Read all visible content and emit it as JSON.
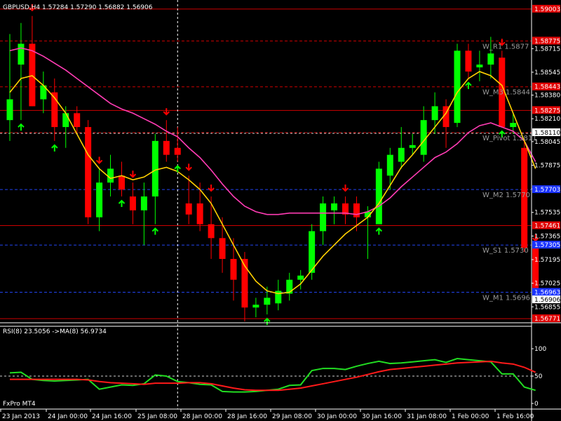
{
  "main_header": "GBPUSD,H4  1.57284 1.57290 1.56882 1.56906",
  "rsi_header": "RSI(8) 23.5056  ->MA(8) 56.9734",
  "broker": "FxPro MT4",
  "colors": {
    "background": "#000000",
    "bull": "#00ff00",
    "bear": "#ff0000",
    "ma_fast": "#ffd000",
    "ma_slow": "#ff3cb4",
    "rsi": "#22dd22",
    "rsi_ma": "#ff1a1a",
    "level_red": "#cc0000",
    "level_blue": "#2244ee",
    "grid_white": "#cfcfcf",
    "price_box": "#ffffff",
    "label_gray": "#9a9a9a"
  },
  "chart_data": [
    {
      "type": "candlestick",
      "symbol": "GBPUSD",
      "timeframe": "H4",
      "ylim": [
        1.5673,
        1.5904
      ],
      "y_ticks": [
        "1.58715",
        "1.58545",
        "1.58380",
        "1.58210",
        "1.58045",
        "1.57875",
        "1.57705",
        "1.57535",
        "1.57365",
        "1.57195",
        "1.57025",
        "1.56855"
      ],
      "x_ticks": [
        "23 Jan 2013",
        "24 Jan 00:00",
        "24 Jan 16:00",
        "25 Jan 08:00",
        "28 Jan 00:00",
        "28 Jan 16:00",
        "29 Jan 08:00",
        "30 Jan 00:00",
        "30 Jan 16:00",
        "31 Jan 08:00",
        "1 Feb 00:00",
        "1 Feb 16:00"
      ],
      "candles": [
        {
          "o": 1.582,
          "h": 1.5882,
          "l": 1.5805,
          "c": 1.5835
        },
        {
          "o": 1.586,
          "h": 1.589,
          "l": 1.582,
          "c": 1.5875
        },
        {
          "o": 1.5875,
          "h": 1.5895,
          "l": 1.583,
          "c": 1.583
        },
        {
          "o": 1.5835,
          "h": 1.5855,
          "l": 1.5825,
          "c": 1.5845
        },
        {
          "o": 1.584,
          "h": 1.585,
          "l": 1.5805,
          "c": 1.5815
        },
        {
          "o": 1.5815,
          "h": 1.583,
          "l": 1.58,
          "c": 1.5825
        },
        {
          "o": 1.5825,
          "h": 1.583,
          "l": 1.581,
          "c": 1.5815
        },
        {
          "o": 1.5815,
          "h": 1.582,
          "l": 1.5745,
          "c": 1.575
        },
        {
          "o": 1.575,
          "h": 1.5785,
          "l": 1.574,
          "c": 1.5775
        },
        {
          "o": 1.5775,
          "h": 1.5795,
          "l": 1.5765,
          "c": 1.5785
        },
        {
          "o": 1.578,
          "h": 1.579,
          "l": 1.5765,
          "c": 1.577
        },
        {
          "o": 1.5765,
          "h": 1.5775,
          "l": 1.5745,
          "c": 1.5755
        },
        {
          "o": 1.5755,
          "h": 1.5775,
          "l": 1.573,
          "c": 1.5765
        },
        {
          "o": 1.5765,
          "h": 1.581,
          "l": 1.5745,
          "c": 1.5805
        },
        {
          "o": 1.5805,
          "h": 1.582,
          "l": 1.579,
          "c": 1.5795
        },
        {
          "o": 1.58,
          "h": 1.5815,
          "l": 1.579,
          "c": 1.5795
        },
        {
          "o": 1.576,
          "h": 1.578,
          "l": 1.5745,
          "c": 1.5752
        },
        {
          "o": 1.576,
          "h": 1.5775,
          "l": 1.574,
          "c": 1.5745
        },
        {
          "o": 1.5745,
          "h": 1.5765,
          "l": 1.572,
          "c": 1.5735
        },
        {
          "o": 1.5735,
          "h": 1.575,
          "l": 1.571,
          "c": 1.572
        },
        {
          "o": 1.572,
          "h": 1.5735,
          "l": 1.569,
          "c": 1.5705
        },
        {
          "o": 1.572,
          "h": 1.5725,
          "l": 1.5675,
          "c": 1.5685
        },
        {
          "o": 1.5685,
          "h": 1.5692,
          "l": 1.5678,
          "c": 1.5687
        },
        {
          "o": 1.5687,
          "h": 1.57,
          "l": 1.568,
          "c": 1.5692
        },
        {
          "o": 1.5688,
          "h": 1.5705,
          "l": 1.5683,
          "c": 1.5697
        },
        {
          "o": 1.5695,
          "h": 1.571,
          "l": 1.569,
          "c": 1.5705
        },
        {
          "o": 1.5705,
          "h": 1.5712,
          "l": 1.5698,
          "c": 1.5708
        },
        {
          "o": 1.571,
          "h": 1.5745,
          "l": 1.5705,
          "c": 1.574
        },
        {
          "o": 1.574,
          "h": 1.5765,
          "l": 1.573,
          "c": 1.576
        },
        {
          "o": 1.5755,
          "h": 1.5765,
          "l": 1.5745,
          "c": 1.576
        },
        {
          "o": 1.576,
          "h": 1.5765,
          "l": 1.5745,
          "c": 1.5752
        },
        {
          "o": 1.576,
          "h": 1.5765,
          "l": 1.574,
          "c": 1.575
        },
        {
          "o": 1.575,
          "h": 1.5758,
          "l": 1.572,
          "c": 1.5754
        },
        {
          "o": 1.5745,
          "h": 1.579,
          "l": 1.5745,
          "c": 1.5785
        },
        {
          "o": 1.578,
          "h": 1.58,
          "l": 1.577,
          "c": 1.5795
        },
        {
          "o": 1.579,
          "h": 1.5815,
          "l": 1.5785,
          "c": 1.58
        },
        {
          "o": 1.58,
          "h": 1.581,
          "l": 1.5795,
          "c": 1.5802
        },
        {
          "o": 1.5795,
          "h": 1.583,
          "l": 1.579,
          "c": 1.582
        },
        {
          "o": 1.582,
          "h": 1.584,
          "l": 1.581,
          "c": 1.583
        },
        {
          "o": 1.583,
          "h": 1.5835,
          "l": 1.58,
          "c": 1.5815
        },
        {
          "o": 1.5818,
          "h": 1.5875,
          "l": 1.5815,
          "c": 1.587
        },
        {
          "o": 1.587,
          "h": 1.5875,
          "l": 1.585,
          "c": 1.5855
        },
        {
          "o": 1.5858,
          "h": 1.587,
          "l": 1.5848,
          "c": 1.586
        },
        {
          "o": 1.586,
          "h": 1.588,
          "l": 1.585,
          "c": 1.5868
        },
        {
          "o": 1.5865,
          "h": 1.587,
          "l": 1.5815,
          "c": 1.5815
        },
        {
          "o": 1.5815,
          "h": 1.5825,
          "l": 1.581,
          "c": 1.5818
        },
        {
          "o": 1.58,
          "h": 1.5805,
          "l": 1.5725,
          "c": 1.5728
        },
        {
          "o": 1.5728,
          "h": 1.5729,
          "l": 1.5688,
          "c": 1.56906
        }
      ],
      "ma_fast": [
        1.584,
        1.585,
        1.5852,
        1.5845,
        1.5836,
        1.5825,
        1.581,
        1.5795,
        1.5785,
        1.5778,
        1.578,
        1.5777,
        1.5779,
        1.5784,
        1.5786,
        1.5783,
        1.5777,
        1.577,
        1.576,
        1.5745,
        1.573,
        1.5715,
        1.5704,
        1.5697,
        1.5695,
        1.5696,
        1.5702,
        1.5712,
        1.5722,
        1.573,
        1.5738,
        1.5744,
        1.575,
        1.576,
        1.5773,
        1.5786,
        1.5795,
        1.5805,
        1.5815,
        1.5825,
        1.584,
        1.585,
        1.5855,
        1.5852,
        1.5845,
        1.5825,
        1.5805,
        1.5785
      ],
      "ma_slow": [
        1.587,
        1.5872,
        1.587,
        1.5866,
        1.5861,
        1.5856,
        1.585,
        1.5844,
        1.5838,
        1.5832,
        1.5828,
        1.5825,
        1.5821,
        1.5817,
        1.5812,
        1.5808,
        1.58,
        1.5793,
        1.5784,
        1.5774,
        1.5765,
        1.5758,
        1.5754,
        1.5752,
        1.5752,
        1.5753,
        1.5753,
        1.5753,
        1.5753,
        1.5753,
        1.5753,
        1.5752,
        1.5754,
        1.5758,
        1.5764,
        1.5772,
        1.5779,
        1.5786,
        1.5793,
        1.5797,
        1.5803,
        1.5811,
        1.5816,
        1.5818,
        1.5815,
        1.5812,
        1.5805,
        1.579
      ],
      "arrows_up": [
        1,
        4,
        10,
        13,
        15,
        23,
        33,
        41,
        44
      ],
      "arrows_down": [
        2,
        8,
        11,
        14,
        16,
        18,
        30,
        44,
        47
      ],
      "levels": [
        {
          "price": 1.5877,
          "label": "W_R1 1.5877",
          "color": "red"
        },
        {
          "price": 1.5844,
          "label": "W_M3 1.5844",
          "color": "red"
        },
        {
          "price": 1.5811,
          "label": "W_Pivot 1.5811",
          "color": "red"
        },
        {
          "price": 1.577,
          "label": "W_M2 1.5770",
          "color": "blue"
        },
        {
          "price": 1.573,
          "label": "W_S1 1.5730",
          "color": "blue"
        },
        {
          "price": 1.5696,
          "label": "W_M1 1.5696",
          "color": "blue"
        }
      ],
      "extra_lines": [
        {
          "price": 1.59,
          "color": "red"
        },
        {
          "price": 1.5827,
          "color": "red"
        },
        {
          "price": 1.5744,
          "color": "red"
        },
        {
          "price": 1.5677,
          "color": "red"
        }
      ],
      "price_boxes": [
        {
          "price": 1.59,
          "text": "1.59003",
          "color": "red"
        },
        {
          "price": 1.5877,
          "text": "1.58775",
          "color": "red"
        },
        {
          "price": 1.5844,
          "text": "1.58443",
          "color": "red"
        },
        {
          "price": 1.5827,
          "text": "1.58275",
          "color": "red"
        },
        {
          "price": 1.5811,
          "text": "1.58110",
          "color": "white"
        },
        {
          "price": 1.577,
          "text": "1.57703",
          "color": "blue"
        },
        {
          "price": 1.5744,
          "text": "1.57461",
          "color": "red"
        },
        {
          "price": 1.573,
          "text": "1.57305",
          "color": "blue"
        },
        {
          "price": 1.5696,
          "text": "1.56963",
          "color": "blue"
        },
        {
          "price": 1.56906,
          "text": "1.56906",
          "color": "white"
        },
        {
          "price": 1.5677,
          "text": "1.56771",
          "color": "red"
        }
      ],
      "vertical_marker_index": 15
    },
    {
      "type": "line",
      "indicator": "RSI",
      "ylim": [
        0,
        100
      ],
      "y_ticks": [
        "100",
        "50",
        "0"
      ],
      "series": [
        {
          "name": "RSI(8)",
          "values": [
            56,
            57,
            44,
            42,
            41,
            42,
            43,
            44,
            26,
            30,
            34,
            33,
            36,
            52,
            50,
            40,
            38,
            35,
            34,
            22,
            21,
            21,
            22,
            24,
            26,
            33,
            34,
            60,
            64,
            64,
            62,
            68,
            73,
            77,
            73,
            74,
            76,
            78,
            80,
            75,
            82,
            80,
            78,
            76,
            54,
            54,
            30,
            24
          ]
        },
        {
          "name": "->MA(8)",
          "values": [
            44,
            44,
            44,
            44,
            44,
            44,
            44,
            43,
            40,
            38,
            37,
            36,
            35,
            37,
            37,
            37,
            38,
            38,
            36,
            32,
            28,
            25,
            24,
            24,
            24,
            26,
            28,
            32,
            36,
            40,
            44,
            48,
            53,
            58,
            62,
            64,
            66,
            68,
            70,
            72,
            74,
            75,
            76,
            77,
            74,
            72,
            66,
            57
          ]
        }
      ]
    }
  ]
}
